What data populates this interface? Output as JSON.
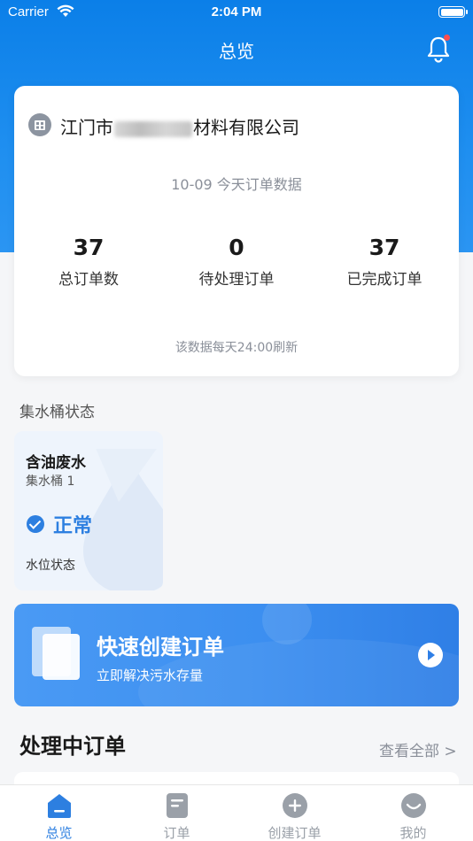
{
  "status_bar": {
    "carrier": "Carrier",
    "time": "2:04 PM"
  },
  "nav": {
    "title": "总览"
  },
  "summary": {
    "company_prefix": "江门市",
    "company_suffix": "材料有限公司",
    "date_line": "10-09 今天订单数据",
    "stats": [
      {
        "value": "37",
        "label": "总订单数"
      },
      {
        "value": "0",
        "label": "待处理订单"
      },
      {
        "value": "37",
        "label": "已完成订单"
      }
    ],
    "refresh_note": "该数据每天24:00刷新"
  },
  "bucket_section": {
    "label": "集水桶状态",
    "card": {
      "title": "含油废水",
      "subtitle": "集水桶 1",
      "status": "正常",
      "level_label": "水位状态"
    }
  },
  "quick_create": {
    "title": "快速创建订单",
    "subtitle": "立即解决污水存量"
  },
  "processing": {
    "title": "处理中订单",
    "view_all": "查看全部 >"
  },
  "tabs": [
    {
      "label": "总览",
      "icon": "home-icon",
      "active": true
    },
    {
      "label": "订单",
      "icon": "order-list-icon",
      "active": false
    },
    {
      "label": "创建订单",
      "icon": "plus-circle-icon",
      "active": false
    },
    {
      "label": "我的",
      "icon": "smile-icon",
      "active": false
    }
  ],
  "colors": {
    "primary": "#2d7fe0",
    "header_blue": "#0b7fe8",
    "badge_red": "#ff4d4f",
    "tab_inactive": "#9aa0a8"
  }
}
